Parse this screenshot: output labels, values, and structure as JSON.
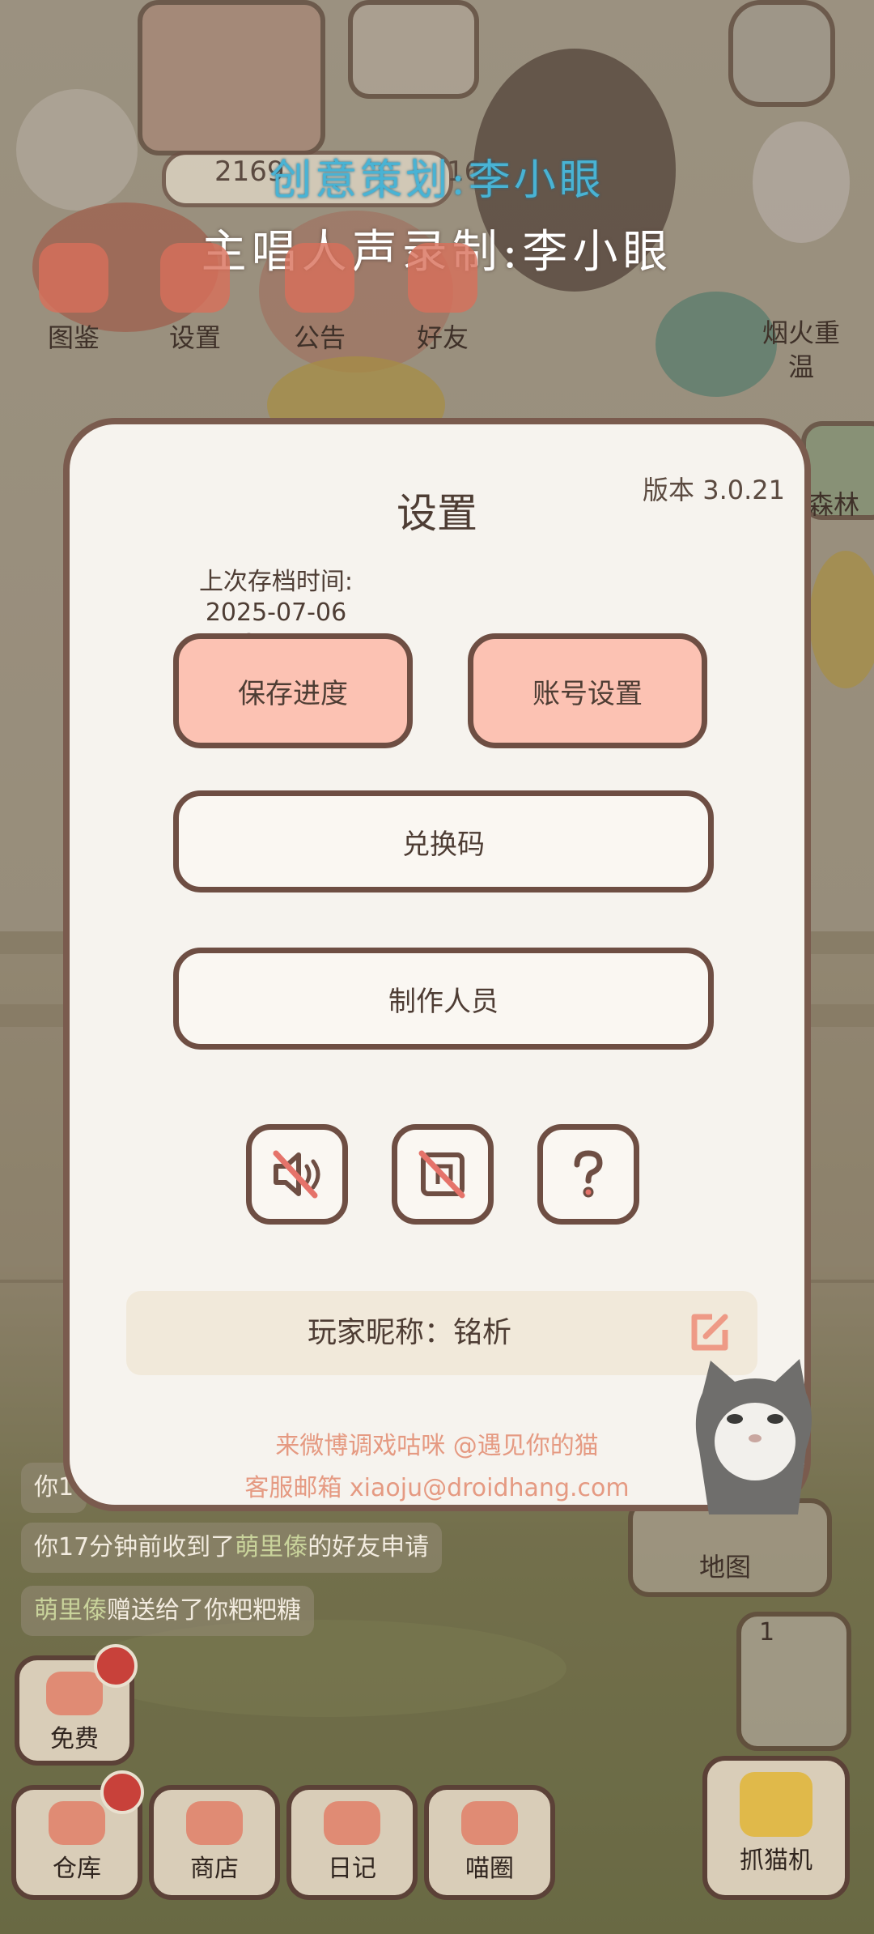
{
  "watermark": {
    "line1": "创意策划:李小眼",
    "line2": "主唱人声录制:李小眼"
  },
  "top_counters": [
    "2169",
    "165"
  ],
  "top_menu": [
    {
      "label": "图鉴",
      "icon": "book-icon"
    },
    {
      "label": "设置",
      "icon": "gear-icon"
    },
    {
      "label": "公告",
      "icon": "gift-icon"
    },
    {
      "label": "好友",
      "icon": "heart-icon"
    }
  ],
  "side": {
    "fireworks_label": "烟火重温",
    "forest_label": "森林",
    "map_label": "地图",
    "machine_count": "1"
  },
  "chat": {
    "line0_prefix": "你1",
    "line1_prefix": "你17分钟前收到了",
    "line1_name": "萌里傣",
    "line1_suffix": "的好友申请",
    "line2_name": "萌里傣",
    "line2_suffix": "赠送给了你粑粑糖"
  },
  "bottom": {
    "free": "免费",
    "warehouse": "仓库",
    "shop": "商店",
    "diary": "日记",
    "meow_circle": "喵圈",
    "claw_machine": "抓猫机"
  },
  "dialog": {
    "title": "设置",
    "version": "版本 3.0.21",
    "save_time_label": "上次存档时间:",
    "save_time_value": "2025-07-06 14:44",
    "save_button": "保存进度",
    "account_button": "账号设置",
    "redeem_button": "兑换码",
    "credits_button": "制作人员",
    "sound_icon": "sound-muted-icon",
    "music_icon": "music-muted-icon",
    "help_icon": "question-icon",
    "nickname": "玩家昵称：铭析",
    "weibo_text": "来微博调戏咕咪 @遇见你的猫",
    "email_text": "客服邮箱 xiaoju@droidhang.com",
    "accent_pink": "#fcc2b3",
    "border_brown": "#6e4e43",
    "link_color": "#e59a82"
  }
}
